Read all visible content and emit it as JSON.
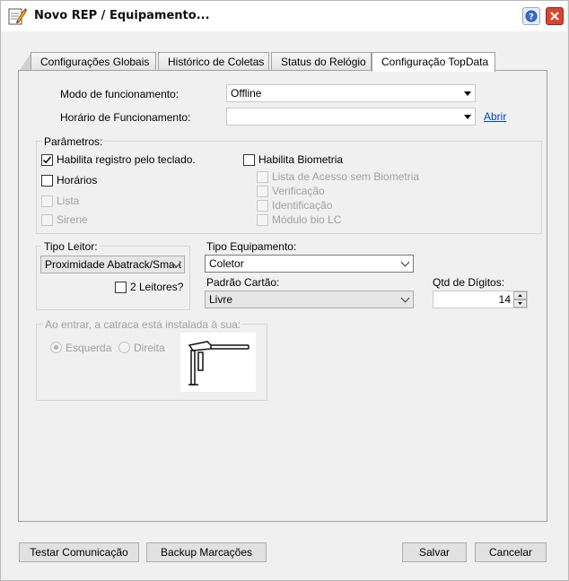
{
  "window": {
    "title": "Novo REP / Equipamento..."
  },
  "tabs": [
    {
      "label": "Configurações Globais"
    },
    {
      "label": "Histórico de Coletas"
    },
    {
      "label": "Status do Relógio"
    },
    {
      "label": "Configuração TopData"
    }
  ],
  "form": {
    "modo_label": "Modo de funcionamento:",
    "modo_value": "Offline",
    "horario_label": "Horário de Funcionamento:",
    "horario_value": "",
    "abrir_link": "Abrir"
  },
  "parametros": {
    "title": "Parâmetros:",
    "left": [
      {
        "label": "Habilita registro pelo teclado.",
        "checked": true,
        "enabled": true
      },
      {
        "label": "Horários",
        "checked": false,
        "enabled": true
      },
      {
        "label": "Lista",
        "checked": false,
        "enabled": false
      },
      {
        "label": "Sirene",
        "checked": false,
        "enabled": false
      }
    ],
    "biometria": {
      "label": "Habilita Biometria",
      "checked": false
    },
    "bio_options": [
      {
        "label": "Lista de Acesso sem Biometria",
        "checked": false
      },
      {
        "label": "Verificação",
        "checked": false
      },
      {
        "label": "Identificação",
        "checked": false
      },
      {
        "label": "Módulo bio LC",
        "checked": false
      }
    ]
  },
  "leitor": {
    "title": "Tipo Leitor:",
    "value": "Proximidade Abatrack/Smart",
    "dois_leitores": "2 Leitores?"
  },
  "equipamento": {
    "tipo_label": "Tipo Equipamento:",
    "tipo_value": "Coletor",
    "padrao_label": "Padrão Cartão:",
    "padrao_value": "Livre",
    "qtd_label": "Qtd de Dígitos:",
    "qtd_value": "14"
  },
  "catraca": {
    "title": "Ao entrar, a catraca está instalada à sua:",
    "esquerda": "Esquerda",
    "direita": "Direita"
  },
  "buttons": {
    "testar": "Testar Comunicação",
    "backup": "Backup Marcações",
    "salvar": "Salvar",
    "cancelar": "Cancelar"
  }
}
